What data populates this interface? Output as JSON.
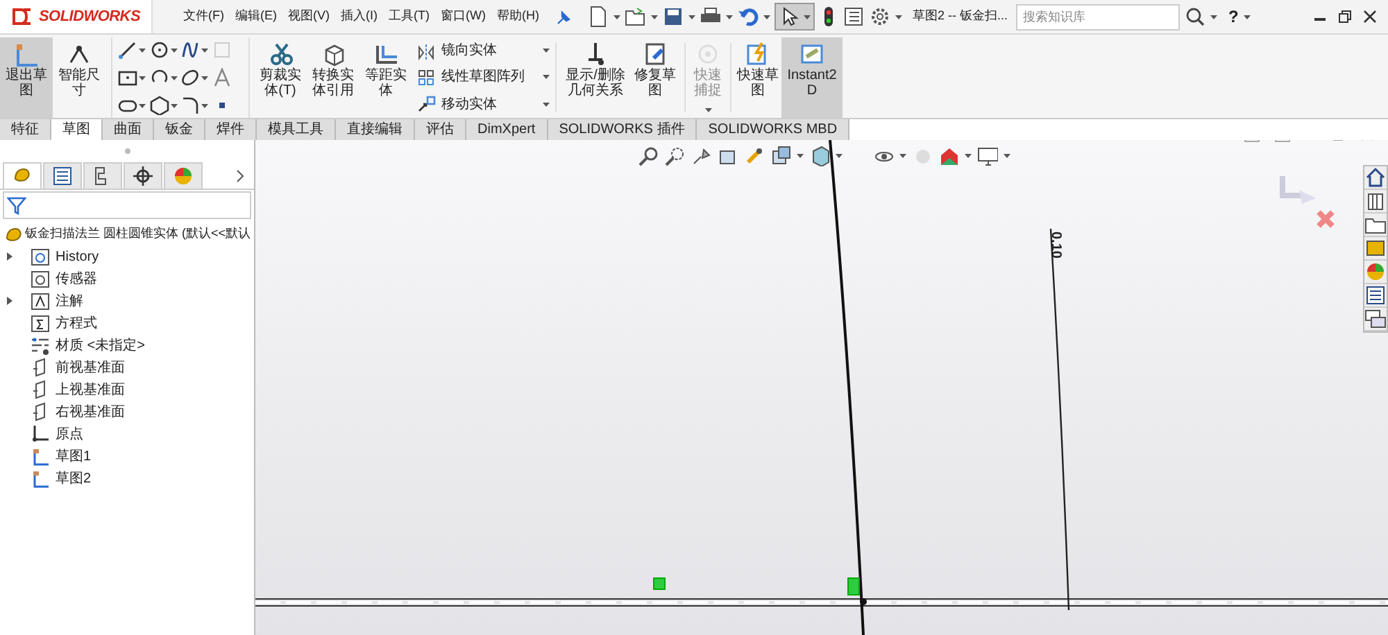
{
  "title_bar": {
    "logo": "SOLIDWORKS",
    "menus": [
      "文件(F)",
      "编辑(E)",
      "视图(V)",
      "插入(I)",
      "工具(T)",
      "窗口(W)",
      "帮助(H)"
    ],
    "document_title": "草图2 -- 钣金扫...",
    "search": {
      "placeholder": "搜索知识库"
    },
    "help": "?"
  },
  "ribbon": [
    {
      "kind": "large",
      "label": "退出草图",
      "selected": true,
      "disabled": false
    },
    {
      "kind": "large",
      "label": "智能尺寸",
      "selected": false,
      "disabled": false
    },
    {
      "kind": "large",
      "label": "剪裁实体(T)",
      "selected": false,
      "disabled": false
    },
    {
      "kind": "large",
      "label": "转换实体引用",
      "selected": false,
      "disabled": false
    },
    {
      "kind": "large",
      "label": "等距实体",
      "selected": false,
      "disabled": false
    },
    {
      "kind": "small",
      "label": "镜向实体",
      "selected": false,
      "disabled": false
    },
    {
      "kind": "small",
      "label": "线性草图阵列",
      "selected": false,
      "disabled": false
    },
    {
      "kind": "small",
      "label": "移动实体",
      "selected": false,
      "disabled": false
    },
    {
      "kind": "large",
      "label": "显示/删除几何关系",
      "selected": false,
      "disabled": false
    },
    {
      "kind": "large",
      "label": "修复草图",
      "selected": false,
      "disabled": false
    },
    {
      "kind": "large",
      "label": "快速捕捉",
      "selected": false,
      "disabled": true
    },
    {
      "kind": "large",
      "label": "快速草图",
      "selected": false,
      "disabled": false
    },
    {
      "kind": "large",
      "label": "Instant2D",
      "selected": true,
      "disabled": false
    }
  ],
  "command_tabs": [
    {
      "label": "特征",
      "selected": false
    },
    {
      "label": "草图",
      "selected": true
    },
    {
      "label": "曲面",
      "selected": false
    },
    {
      "label": "钣金",
      "selected": false
    },
    {
      "label": "焊件",
      "selected": false
    },
    {
      "label": "模具工具",
      "selected": false
    },
    {
      "label": "直接编辑",
      "selected": false
    },
    {
      "label": "评估",
      "selected": false
    },
    {
      "label": "DimXpert",
      "selected": false
    },
    {
      "label": "SOLIDWORKS 插件",
      "selected": false
    },
    {
      "label": "SOLIDWORKS MBD",
      "selected": false
    }
  ],
  "feature_tree": {
    "root": "钣金扫描法兰 圆柱圆锥实体  (默认<<默认",
    "items": [
      {
        "label": "History",
        "kind": "folder",
        "expandable": true
      },
      {
        "label": "传感器",
        "kind": "sensor",
        "expandable": false
      },
      {
        "label": "注解",
        "kind": "annotation",
        "expandable": true
      },
      {
        "label": "方程式",
        "kind": "equation",
        "expandable": false
      },
      {
        "label": "材质 <未指定>",
        "kind": "material",
        "expandable": false
      },
      {
        "label": "前视基准面",
        "kind": "plane",
        "expandable": false
      },
      {
        "label": "上视基准面",
        "kind": "plane",
        "expandable": false
      },
      {
        "label": "右视基准面",
        "kind": "plane",
        "expandable": false
      },
      {
        "label": "原点",
        "kind": "origin",
        "expandable": false
      },
      {
        "label": "草图1",
        "kind": "sketch",
        "expandable": false
      },
      {
        "label": "草图2",
        "kind": "sketch",
        "expandable": false
      }
    ]
  },
  "canvas": {
    "dimension": "0.10"
  }
}
